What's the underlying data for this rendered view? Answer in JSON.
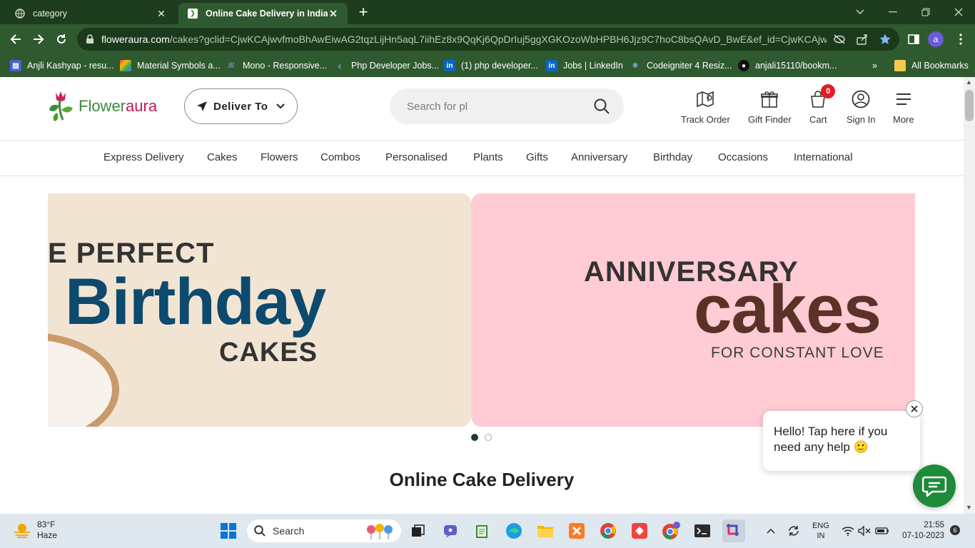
{
  "browser": {
    "tabs": [
      {
        "title": "category",
        "active": false
      },
      {
        "title": "Online Cake Delivery in India | C",
        "active": true
      }
    ],
    "url_host": "floweraura.com",
    "url_path": "/cakes?gclid=CjwKCAjwvfmoBhAwEiwAG2tqzLijHn5aqL7iihEz8x9QqKj6QpDrIuj5ggXGKOzoWbHPBH6Jjz9C7hoC8bsQAvD_BwE&ef_id=CjwKCAjwvfm...",
    "profile_initial": "a",
    "bookmarks": [
      "Anjli Kashyap - resu...",
      "Material Symbols a...",
      "Mono - Responsive...",
      "Php Developer Jobs...",
      "(1) php developer...",
      "Jobs | LinkedIn",
      "Codeigniter 4 Resiz...",
      "anjali15110/bookm..."
    ],
    "all_bookmarks": "All Bookmarks"
  },
  "header": {
    "logo_text_1": "Flower",
    "logo_text_2": "aura",
    "deliver_label": "Deliver To",
    "search_placeholder": "Search for pl",
    "icons": [
      {
        "label": "Track Order",
        "icon": "map-icon"
      },
      {
        "label": "Gift Finder",
        "icon": "gift-icon"
      },
      {
        "label": "Cart",
        "icon": "cart-icon",
        "badge": "0"
      },
      {
        "label": "Sign In",
        "icon": "user-icon"
      },
      {
        "label": "More",
        "icon": "menu-icon"
      }
    ]
  },
  "categories": [
    "Express Delivery",
    "Cakes",
    "Flowers",
    "Combos",
    "Personalised",
    "Plants",
    "Gifts",
    "Anniversary",
    "Birthday",
    "Occasions",
    "International"
  ],
  "banner": {
    "slide1": {
      "line1": "E PERFECT",
      "line2": "Birthday",
      "line3": "CAKES"
    },
    "slide2": {
      "line1": "ANNIVERSARY",
      "line2": "cakes",
      "line3": "FOR CONSTANT LOVE"
    }
  },
  "page_title": "Online Cake Delivery",
  "chat": {
    "message": "Hello! Tap here if you need any help 🙂"
  },
  "taskbar": {
    "temperature": "83°F",
    "weather": "Haze",
    "search_label": "Search",
    "language": "ENG",
    "region": "IN",
    "time": "21:55",
    "date": "07-10-2023",
    "notifications": "6"
  },
  "colors": {
    "brand_green": "#3d8b3d",
    "brand_pink": "#c2185b",
    "chat_green": "#1f8a3a",
    "badge_red": "#e51c23"
  }
}
